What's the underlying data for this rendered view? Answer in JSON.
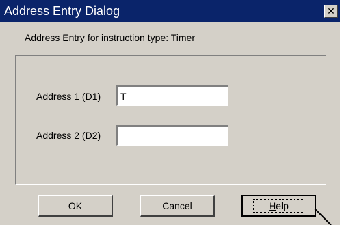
{
  "window": {
    "title": "Address Entry Dialog",
    "close_glyph": "✕"
  },
  "header": {
    "subtitle": "Address Entry for instruction type:  Timer"
  },
  "fields": [
    {
      "label_pre": "Address ",
      "label_key": "1",
      "label_post": "  (D1)",
      "value": "T"
    },
    {
      "label_pre": "Address ",
      "label_key": "2",
      "label_post": "  (D2)",
      "value": ""
    }
  ],
  "buttons": {
    "ok": "OK",
    "cancel": "Cancel",
    "help_key": "H",
    "help_rest": "elp"
  }
}
